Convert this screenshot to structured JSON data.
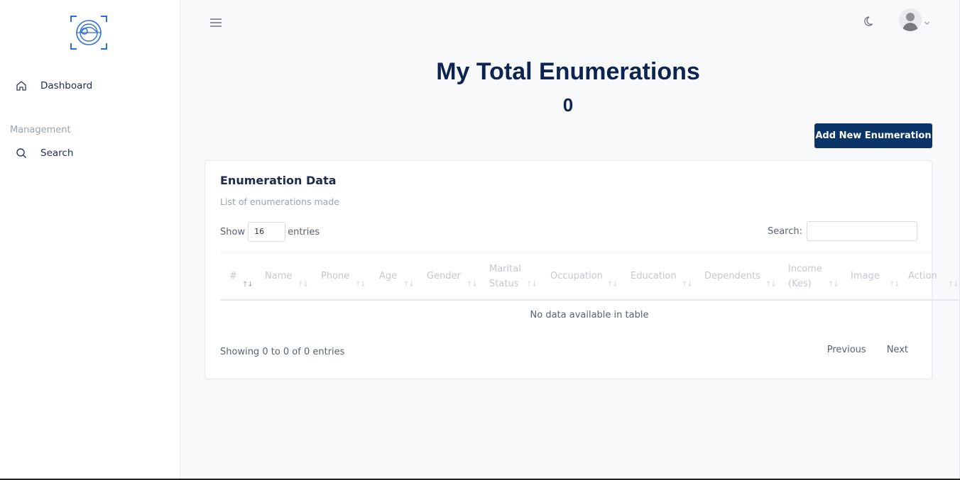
{
  "sidebar": {
    "items": [
      {
        "label": "Dashboard",
        "icon": "home-icon"
      },
      {
        "label": "Search",
        "icon": "search-icon"
      }
    ],
    "section_label": "Management"
  },
  "topbar": {
    "menu_icon": "hamburger-icon",
    "theme_icon": "moon-icon",
    "avatar_icon": "user-avatar"
  },
  "page": {
    "title": "My Total Enumerations",
    "count": "0",
    "add_button_label": "Add New Enumeration"
  },
  "card": {
    "title": "Enumeration Data",
    "subtitle": "List of enumerations made",
    "show_label": "Show",
    "entries_value": "16",
    "entries_label": "entries",
    "search_label": "Search:",
    "search_value": ""
  },
  "table": {
    "columns": [
      {
        "line1": "#",
        "line2": ""
      },
      {
        "line1": "Name",
        "line2": ""
      },
      {
        "line1": "Phone",
        "line2": ""
      },
      {
        "line1": "Age",
        "line2": ""
      },
      {
        "line1": "Gender",
        "line2": ""
      },
      {
        "line1": "Marital",
        "line2": "Status"
      },
      {
        "line1": "Occupation",
        "line2": ""
      },
      {
        "line1": "Education",
        "line2": ""
      },
      {
        "line1": "Dependents",
        "line2": ""
      },
      {
        "line1": "Income",
        "line2": "(Kes)"
      },
      {
        "line1": "Image",
        "line2": ""
      },
      {
        "line1": "Action",
        "line2": ""
      }
    ],
    "empty_message": "No data available in table",
    "info": "Showing 0 to 0 of 0 entries",
    "prev_label": "Previous",
    "next_label": "Next"
  },
  "colors": {
    "primary": "#0b3568",
    "title": "#0d2350",
    "background": "#f8f9fb"
  }
}
